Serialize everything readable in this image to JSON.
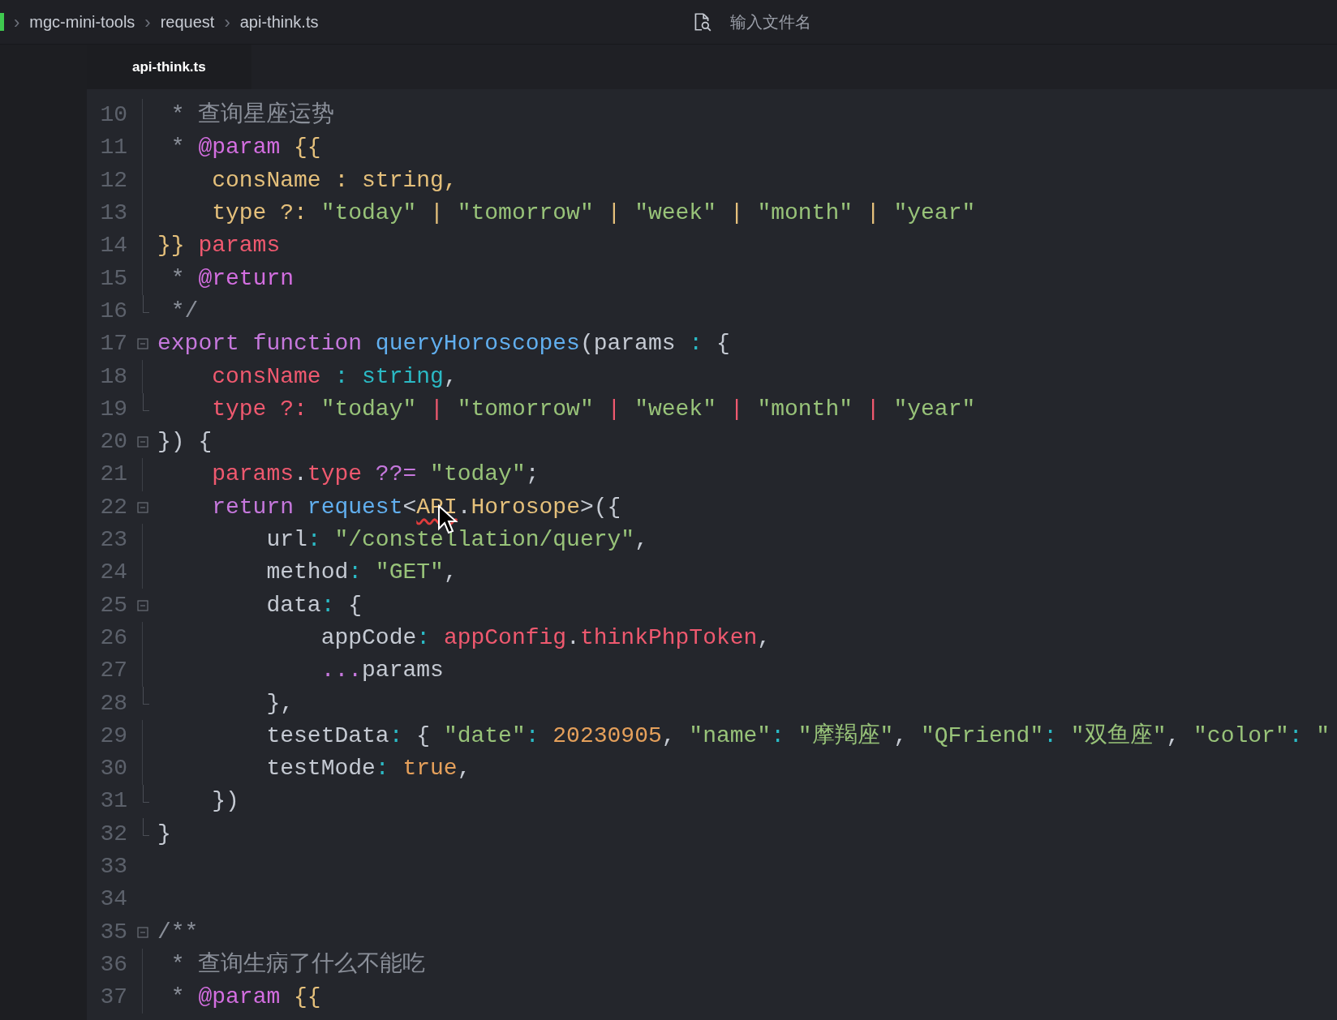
{
  "breadcrumb": {
    "items": [
      {
        "separator": "›",
        "label": "mgc-mini-tools"
      },
      {
        "separator": "›",
        "label": "request"
      },
      {
        "separator": "›",
        "label": "api-think.ts"
      }
    ]
  },
  "search": {
    "placeholder": "输入文件名"
  },
  "tabs": [
    {
      "label": "api-think.ts",
      "selected": true
    }
  ],
  "editor": {
    "lines": [
      {
        "number": "10",
        "kind": "guide",
        "tokens": [
          {
            "text": " * 查询星座运势",
            "kind": "comment"
          }
        ]
      },
      {
        "number": "11",
        "kind": "guide",
        "tokens": [
          {
            "text": " * ",
            "kind": "comment"
          },
          {
            "text": "@param",
            "kind": "tag"
          },
          {
            "text": " {{",
            "kind": "class"
          }
        ]
      },
      {
        "number": "12",
        "kind": "guide",
        "tokens": [
          {
            "text": "    consName : string,",
            "kind": "class"
          }
        ]
      },
      {
        "number": "13",
        "kind": "guide",
        "tokens": [
          {
            "text": "    type ?: ",
            "kind": "class"
          },
          {
            "text": "\"today\"",
            "kind": "string"
          },
          {
            "text": " | ",
            "kind": "class"
          },
          {
            "text": "\"tomorrow\"",
            "kind": "string"
          },
          {
            "text": " | ",
            "kind": "class"
          },
          {
            "text": "\"week\"",
            "kind": "string"
          },
          {
            "text": " | ",
            "kind": "class"
          },
          {
            "text": "\"month\"",
            "kind": "string"
          },
          {
            "text": " | ",
            "kind": "class"
          },
          {
            "text": "\"year\"",
            "kind": "string"
          }
        ]
      },
      {
        "number": "14",
        "kind": "guide",
        "tokens": [
          {
            "text": "}}",
            "kind": "class"
          },
          {
            "text": " params",
            "kind": "variable"
          }
        ]
      },
      {
        "number": "15",
        "kind": "guide",
        "tokens": [
          {
            "text": " * ",
            "kind": "comment"
          },
          {
            "text": "@return",
            "kind": "tag"
          }
        ]
      },
      {
        "number": "16",
        "kind": "end",
        "tokens": [
          {
            "text": " */",
            "kind": "comment"
          }
        ]
      },
      {
        "number": "17",
        "kind": "start",
        "tokens": [
          {
            "text": "export ",
            "kind": "keyword"
          },
          {
            "text": "function ",
            "kind": "keyword"
          },
          {
            "text": "queryHoroscopes",
            "kind": "function"
          },
          {
            "text": "(params",
            "kind": "plain"
          },
          {
            "text": " : ",
            "kind": "operator"
          },
          {
            "text": "{",
            "kind": "plain"
          }
        ]
      },
      {
        "number": "18",
        "kind": "guide",
        "tokens": [
          {
            "text": "    consName",
            "kind": "variable"
          },
          {
            "text": " : ",
            "kind": "operator"
          },
          {
            "text": "string",
            "kind": "type"
          },
          {
            "text": ",",
            "kind": "plain"
          }
        ]
      },
      {
        "number": "19",
        "kind": "end",
        "tokens": [
          {
            "text": "    type ?: ",
            "kind": "variable"
          },
          {
            "text": "\"today\"",
            "kind": "string"
          },
          {
            "text": " | ",
            "kind": "variable"
          },
          {
            "text": "\"tomorrow\"",
            "kind": "string"
          },
          {
            "text": " | ",
            "kind": "variable"
          },
          {
            "text": "\"week\"",
            "kind": "string"
          },
          {
            "text": " | ",
            "kind": "variable"
          },
          {
            "text": "\"month\"",
            "kind": "string"
          },
          {
            "text": " | ",
            "kind": "variable"
          },
          {
            "text": "\"year\"",
            "kind": "string"
          }
        ]
      },
      {
        "number": "20",
        "kind": "start",
        "tokens": [
          {
            "text": "}) {",
            "kind": "plain"
          }
        ]
      },
      {
        "number": "21",
        "kind": "guide",
        "tokens": [
          {
            "text": "    params",
            "kind": "variable"
          },
          {
            "text": ".",
            "kind": "plain"
          },
          {
            "text": "type",
            "kind": "variable"
          },
          {
            "text": " ??= ",
            "kind": "keyword"
          },
          {
            "text": "\"today\"",
            "kind": "string"
          },
          {
            "text": ";",
            "kind": "plain"
          }
        ]
      },
      {
        "number": "22",
        "kind": "start",
        "tokens": [
          {
            "text": "    return ",
            "kind": "keyword"
          },
          {
            "text": "request",
            "kind": "function"
          },
          {
            "text": "<",
            "kind": "plain"
          },
          {
            "text": "API",
            "kind": "class",
            "error": true
          },
          {
            "text": ".",
            "kind": "plain"
          },
          {
            "text": "Horosope",
            "kind": "class"
          },
          {
            "text": ">({",
            "kind": "plain"
          }
        ]
      },
      {
        "number": "23",
        "kind": "guide",
        "tokens": [
          {
            "text": "        url",
            "kind": "plain"
          },
          {
            "text": ": ",
            "kind": "operator"
          },
          {
            "text": "\"/constellation/query\"",
            "kind": "string"
          },
          {
            "text": ",",
            "kind": "plain"
          }
        ]
      },
      {
        "number": "24",
        "kind": "guide",
        "tokens": [
          {
            "text": "        method",
            "kind": "plain"
          },
          {
            "text": ": ",
            "kind": "operator"
          },
          {
            "text": "\"GET\"",
            "kind": "string"
          },
          {
            "text": ",",
            "kind": "plain"
          }
        ]
      },
      {
        "number": "25",
        "kind": "start",
        "tokens": [
          {
            "text": "        data",
            "kind": "plain"
          },
          {
            "text": ": ",
            "kind": "operator"
          },
          {
            "text": "{",
            "kind": "plain"
          }
        ]
      },
      {
        "number": "26",
        "kind": "guide",
        "tokens": [
          {
            "text": "            appCode",
            "kind": "plain"
          },
          {
            "text": ": ",
            "kind": "operator"
          },
          {
            "text": "appConfig",
            "kind": "variable"
          },
          {
            "text": ".",
            "kind": "plain"
          },
          {
            "text": "thinkPhpToken",
            "kind": "variable"
          },
          {
            "text": ",",
            "kind": "plain"
          }
        ]
      },
      {
        "number": "27",
        "kind": "guide",
        "tokens": [
          {
            "text": "            ...",
            "kind": "keyword"
          },
          {
            "text": "params",
            "kind": "plain"
          }
        ]
      },
      {
        "number": "28",
        "kind": "end",
        "tokens": [
          {
            "text": "        },",
            "kind": "plain"
          }
        ]
      },
      {
        "number": "29",
        "kind": "guide",
        "tokens": [
          {
            "text": "        tesetData",
            "kind": "plain"
          },
          {
            "text": ": ",
            "kind": "operator"
          },
          {
            "text": "{ ",
            "kind": "plain"
          },
          {
            "text": "\"date\"",
            "kind": "string"
          },
          {
            "text": ": ",
            "kind": "operator"
          },
          {
            "text": "20230905",
            "kind": "number"
          },
          {
            "text": ", ",
            "kind": "plain"
          },
          {
            "text": "\"name\"",
            "kind": "string"
          },
          {
            "text": ": ",
            "kind": "operator"
          },
          {
            "text": "\"摩羯座\"",
            "kind": "string"
          },
          {
            "text": ", ",
            "kind": "plain"
          },
          {
            "text": "\"QFriend\"",
            "kind": "string"
          },
          {
            "text": ": ",
            "kind": "operator"
          },
          {
            "text": "\"双鱼座\"",
            "kind": "string"
          },
          {
            "text": ", ",
            "kind": "plain"
          },
          {
            "text": "\"color\"",
            "kind": "string"
          },
          {
            "text": ": ",
            "kind": "operator"
          },
          {
            "text": "\"",
            "kind": "string"
          }
        ]
      },
      {
        "number": "30",
        "kind": "guide",
        "tokens": [
          {
            "text": "        testMode",
            "kind": "plain"
          },
          {
            "text": ": ",
            "kind": "operator"
          },
          {
            "text": "true",
            "kind": "number"
          },
          {
            "text": ",",
            "kind": "plain"
          }
        ]
      },
      {
        "number": "31",
        "kind": "end",
        "tokens": [
          {
            "text": "    })",
            "kind": "plain"
          }
        ]
      },
      {
        "number": "32",
        "kind": "end",
        "tokens": [
          {
            "text": "}",
            "kind": "plain"
          }
        ]
      },
      {
        "number": "33",
        "kind": "none"
      },
      {
        "number": "34",
        "kind": "none"
      },
      {
        "number": "35",
        "kind": "start",
        "tokens": [
          {
            "text": "/**",
            "kind": "comment"
          }
        ]
      },
      {
        "number": "36",
        "kind": "guide",
        "tokens": [
          {
            "text": " * 查询生病了什么不能吃",
            "kind": "comment"
          }
        ]
      },
      {
        "number": "37",
        "kind": "guide",
        "tokens": [
          {
            "text": " * ",
            "kind": "comment"
          },
          {
            "text": "@param",
            "kind": "tag"
          },
          {
            "text": " {{",
            "kind": "class"
          }
        ]
      }
    ]
  }
}
